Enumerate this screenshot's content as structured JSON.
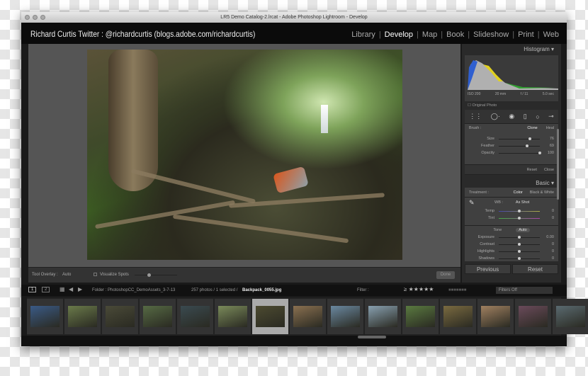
{
  "window": {
    "title": "LR5 Demo Catalog-2.lrcat - Adobe Photoshop Lightroom - Develop"
  },
  "header": {
    "identity_plate": "Richard Curtis Twitter : @richardcurtis (blogs.adobe.com/richardcurtis)",
    "modules": [
      {
        "label": "Library",
        "active": false
      },
      {
        "label": "Develop",
        "active": true
      },
      {
        "label": "Map",
        "active": false
      },
      {
        "label": "Book",
        "active": false
      },
      {
        "label": "Slideshow",
        "active": false
      },
      {
        "label": "Print",
        "active": false
      },
      {
        "label": "Web",
        "active": false
      }
    ]
  },
  "histogram": {
    "title": "Histogram",
    "iso": "ISO 200",
    "focal": "20 mm",
    "aperture": "f / 11",
    "shutter": "5.0 sec",
    "original_photo": "Original Photo"
  },
  "brush": {
    "label": "Brush :",
    "clone": "Clone",
    "heal": "Heal",
    "sliders": [
      {
        "label": "Size",
        "value": "76",
        "level": 0.76
      },
      {
        "label": "Feather",
        "value": "69",
        "level": 0.69
      },
      {
        "label": "Opacity",
        "value": "100",
        "level": 1.0
      }
    ],
    "reset": "Reset",
    "close": "Close"
  },
  "basic": {
    "title": "Basic",
    "treatment_label": "Treatment :",
    "color": "Color",
    "bw": "Black & White",
    "wb_label": "WB :",
    "wb_value": "As Shot",
    "wb_sliders": [
      {
        "label": "Temp",
        "value": "0"
      },
      {
        "label": "Tint",
        "value": "0"
      }
    ],
    "tone_label": "Tone",
    "auto": "Auto",
    "tone_sliders": [
      {
        "label": "Exposure",
        "value": "0.00"
      },
      {
        "label": "Contrast",
        "value": "0"
      },
      {
        "label": "Highlights",
        "value": "0"
      },
      {
        "label": "Shadows",
        "value": "0"
      }
    ]
  },
  "panel_buttons": {
    "previous": "Previous",
    "reset": "Reset"
  },
  "toolbar": {
    "tool_overlay_label": "Tool Overlay :",
    "tool_overlay_value": "Auto",
    "visualize_spots": "Visualize Spots",
    "done": "Done"
  },
  "filmstrip": {
    "view1": "1",
    "view2": "2",
    "folder": "Folder : PhotoshopCC_DemoAssets_3-7-13",
    "count": "257 photos / 1 selected /",
    "filename": "Backpack_0055.jpg",
    "filter_label": "Filter :",
    "filter_value": "Filters Off",
    "selected_index": 6,
    "thumbs": [
      "#3a5a86",
      "#6a7a4a",
      "#4a4a38",
      "#566a44",
      "#3a4a50",
      "#7a8a5a",
      "#4c4a30",
      "#8a7050",
      "#6a88a0",
      "#88a0b0",
      "#5a7a40",
      "#7a6a40",
      "#a08060",
      "#6a4a5a",
      "#5a6a70"
    ]
  }
}
